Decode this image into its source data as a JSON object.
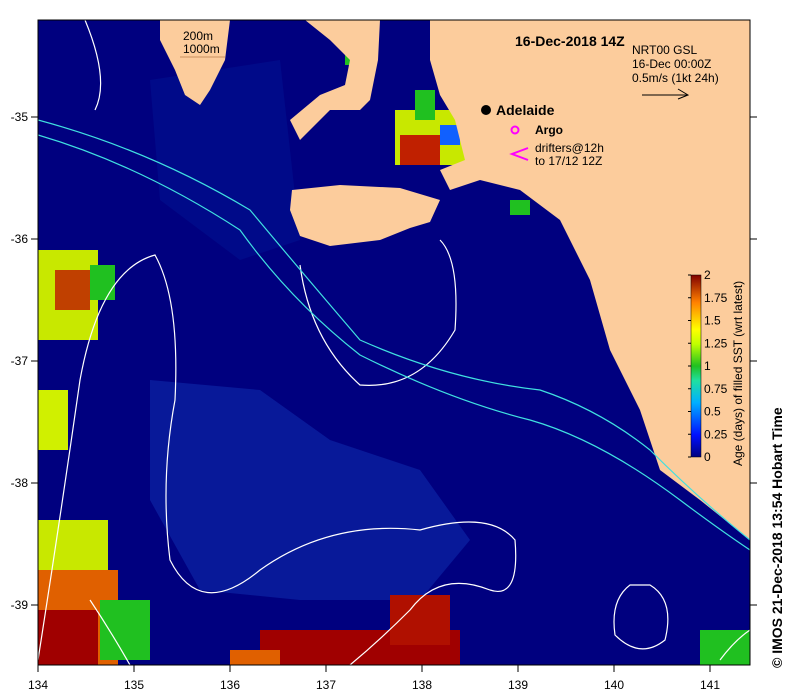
{
  "map": {
    "title": "16-Dec-2018 14Z",
    "product": "NRT00 GSL",
    "current_time": "16-Dec 00:00Z",
    "arrow_scale": "0.5m/s (1kt 24h)",
    "depth_legend": [
      "200m",
      "1000m"
    ],
    "city": "Adelaide",
    "argo_label": "Argo",
    "drifters_label_1": "drifters@12h",
    "drifters_label_2": "to 17/12 12Z",
    "credit": "© IMOS 21-Dec-2018 13:54 Hobart Time",
    "x_ticks": [
      "134",
      "135",
      "136",
      "137",
      "138",
      "139",
      "140",
      "141"
    ],
    "y_ticks": [
      "-35",
      "-36",
      "-37",
      "-38",
      "-39"
    ],
    "colorbar": {
      "label": "Age (days) of filled SST (wrt latest)",
      "ticks": [
        "0",
        "0.25",
        "0.5",
        "0.75",
        "1",
        "1.25",
        "1.5",
        "1.75",
        "2"
      ],
      "range": [
        0,
        2
      ]
    },
    "colors": {
      "land": "#fccc9c",
      "ocean": "#00007f",
      "shelf": "#0a22a8",
      "depth200": "#ffffff",
      "depth1000": "#40e0e0",
      "argo": "#ff00ff"
    }
  }
}
